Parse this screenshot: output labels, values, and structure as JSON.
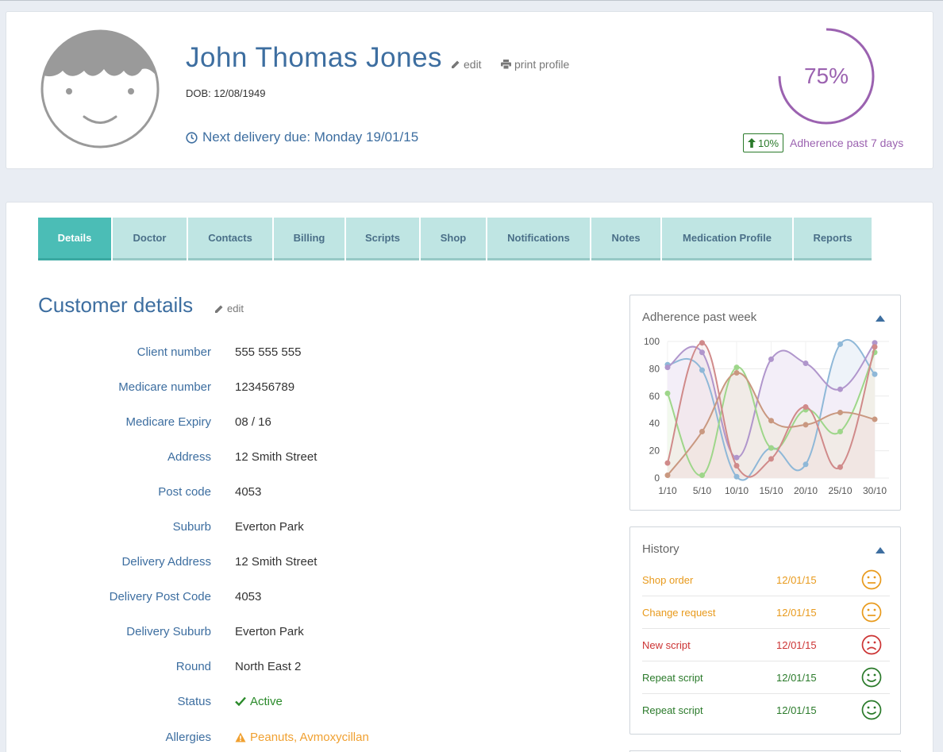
{
  "profile": {
    "name": "John Thomas Jones",
    "edit_label": "edit",
    "print_label": "print profile",
    "dob": "DOB: 12/08/1949",
    "next_delivery": "Next delivery due: Monday 19/01/15",
    "adherence_percent": "75%",
    "adherence_fraction": 0.75,
    "trend": "10%",
    "adherence_label": "Adherence past 7 days",
    "accent_color": "#9b62b0"
  },
  "tabs": [
    {
      "label": "Details",
      "active": true
    },
    {
      "label": "Doctor",
      "active": false
    },
    {
      "label": "Contacts",
      "active": false
    },
    {
      "label": "Billing",
      "active": false
    },
    {
      "label": "Scripts",
      "active": false
    },
    {
      "label": "Shop",
      "active": false
    },
    {
      "label": "Notifications",
      "active": false
    },
    {
      "label": "Notes",
      "active": false
    },
    {
      "label": "Medication Profile",
      "active": false
    },
    {
      "label": "Reports",
      "active": false
    }
  ],
  "customer": {
    "title": "Customer details",
    "edit_label": "edit",
    "fields": [
      {
        "label": "Client number",
        "value": "555 555 555"
      },
      {
        "label": "Medicare number",
        "value": "123456789"
      },
      {
        "label": "Medicare Expiry",
        "value": "08 / 16"
      },
      {
        "label": "Address",
        "value": "12 Smith Street"
      },
      {
        "label": "Post code",
        "value": "4053"
      },
      {
        "label": "Suburb",
        "value": "Everton Park"
      },
      {
        "label": "Delivery Address",
        "value": "12 Smith Street"
      },
      {
        "label": "Delivery Post Code",
        "value": "4053"
      },
      {
        "label": "Delivery Suburb",
        "value": "Everton Park"
      },
      {
        "label": "Round",
        "value": "North East 2"
      },
      {
        "label": "Status",
        "value": "Active",
        "icon": "check-icon"
      },
      {
        "label": "Allergies",
        "value": "Peanuts, Avmoxycillan",
        "icon": "warning-icon"
      }
    ]
  },
  "chart_panel": {
    "title": "Adherence past week"
  },
  "chart_data": {
    "type": "line",
    "title": "Adherence past week",
    "categories": [
      "1/10",
      "5/10",
      "10/10",
      "15/10",
      "20/10",
      "25/10",
      "30/10"
    ],
    "ylim": [
      0,
      100
    ],
    "yticks": [
      0,
      20,
      40,
      60,
      80,
      100
    ],
    "grid": true,
    "series": [
      {
        "color": "#8fb8d8",
        "fill": "#eef3f9",
        "values": [
          83,
          79,
          1,
          22,
          10,
          98,
          76
        ]
      },
      {
        "color": "#b096cc",
        "fill": "#f3eef8",
        "values": [
          81,
          92,
          15,
          87,
          84,
          65,
          99
        ]
      },
      {
        "color": "#9ed68a",
        "fill": "#f2f9ee",
        "values": [
          62,
          2,
          81,
          22,
          50,
          34,
          92
        ]
      },
      {
        "color": "#c99880",
        "fill": "#f1ebe7",
        "values": [
          2,
          34,
          77,
          42,
          39,
          48,
          43
        ]
      },
      {
        "color": "#d08a8a",
        "fill": "rgba(240,220,220,0.35)",
        "values": [
          11,
          99,
          9,
          14,
          52,
          8,
          96
        ]
      }
    ]
  },
  "history": {
    "title": "History",
    "items": [
      {
        "name": "Shop order",
        "date": "12/01/15",
        "mood": "neutral",
        "color": "#e89a1c"
      },
      {
        "name": "Change request",
        "date": "12/01/15",
        "mood": "neutral",
        "color": "#e89a1c"
      },
      {
        "name": "New script",
        "date": "12/01/15",
        "mood": "sad",
        "color": "#cc3333"
      },
      {
        "name": "Repeat script",
        "date": "12/01/15",
        "mood": "happy",
        "color": "#2a7a2a"
      },
      {
        "name": "Repeat script",
        "date": "12/01/15",
        "mood": "happy",
        "color": "#2a7a2a"
      }
    ]
  }
}
